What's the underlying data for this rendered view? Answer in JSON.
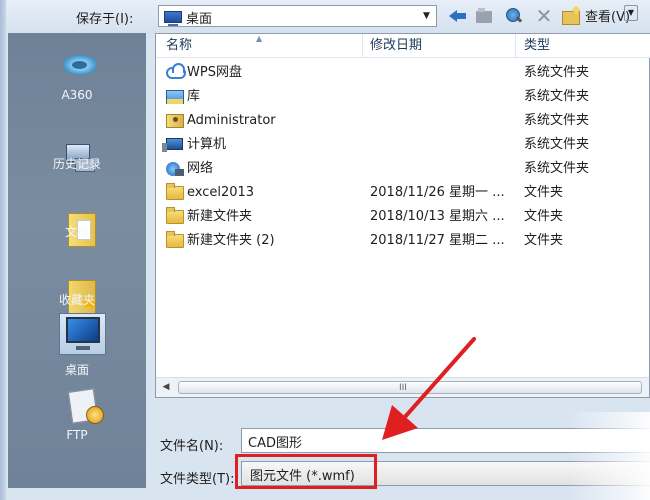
{
  "toolbar": {
    "save_in_label": "保存于(I):",
    "location_value": "桌面",
    "views_label": "查看(V)",
    "icons": [
      "back-icon",
      "up-folder-icon",
      "search-web-icon",
      "delete-icon",
      "new-folder-icon",
      "views-icon"
    ]
  },
  "places": [
    {
      "label": "A360",
      "icon": "a360-icon"
    },
    {
      "label": "历史记录",
      "icon": "history-icon"
    },
    {
      "label": "文档",
      "icon": "documents-icon"
    },
    {
      "label": "收藏夹",
      "icon": "favorites-icon"
    },
    {
      "label": "桌面",
      "icon": "desktop-icon"
    },
    {
      "label": "FTP",
      "icon": "ftp-icon"
    }
  ],
  "columns": {
    "name": "名称",
    "modified": "修改日期",
    "type": "类型"
  },
  "files": [
    {
      "name": "WPS网盘",
      "modified": "",
      "type": "系统文件夹",
      "icon": "cloud-icon"
    },
    {
      "name": "库",
      "modified": "",
      "type": "系统文件夹",
      "icon": "library-icon"
    },
    {
      "name": "Administrator",
      "modified": "",
      "type": "系统文件夹",
      "icon": "user-folder-icon"
    },
    {
      "name": "计算机",
      "modified": "",
      "type": "系统文件夹",
      "icon": "computer-icon"
    },
    {
      "name": "网络",
      "modified": "",
      "type": "系统文件夹",
      "icon": "network-icon"
    },
    {
      "name": "excel2013",
      "modified": "2018/11/26 星期一 ...",
      "type": "文件夹",
      "icon": "folder-icon"
    },
    {
      "name": "新建文件夹",
      "modified": "2018/10/13 星期六 ...",
      "type": "文件夹",
      "icon": "folder-icon"
    },
    {
      "name": "新建文件夹 (2)",
      "modified": "2018/11/27 星期二 ...",
      "type": "文件夹",
      "icon": "folder-icon"
    }
  ],
  "scrollbar": {
    "grip": "III"
  },
  "filename": {
    "label": "文件名(N):",
    "value": "CAD图形"
  },
  "filetype": {
    "label": "文件类型(T):",
    "value": "图元文件 (*.wmf)"
  },
  "annotation": {
    "color": "#e02020"
  }
}
